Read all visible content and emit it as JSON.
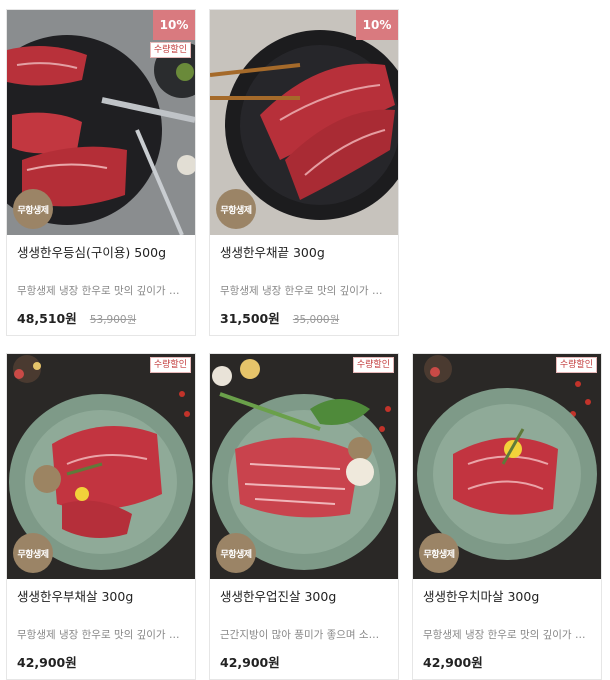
{
  "products": [
    {
      "name": "생생한우등심(구이용) 500g",
      "desc": "무항생제 냉장 한우로 맛의 깊이가 다르다",
      "price": "48,510원",
      "original_price": "53,900원",
      "discount": "10%",
      "tag": "수량할인",
      "badge": "무항생제"
    },
    {
      "name": "생생한우채끝 300g",
      "desc": "무항생제 냉장 한우로 맛의 깊이가 다르다",
      "price": "31,500원",
      "original_price": "35,000원",
      "discount": "10%",
      "tag": "",
      "badge": "무항생제"
    },
    {
      "name": "생생한우부채살 300g",
      "desc": "무항생제 냉장 한우로 맛의 깊이가 다르다",
      "price": "42,900원",
      "original_price": "",
      "discount": "",
      "tag": "수량할인",
      "badge": "무항생제"
    },
    {
      "name": "생생한우업진살 300g",
      "desc": "근간지방이 많아 풍미가 좋으며 소고기 본연의 맛",
      "price": "42,900원",
      "original_price": "",
      "discount": "",
      "tag": "수량할인",
      "badge": "무항생제"
    },
    {
      "name": "생생한우치마살 300g",
      "desc": "무항생제 냉장 한우로 맛의 깊이가 다르다",
      "price": "42,900원",
      "original_price": "",
      "discount": "",
      "tag": "수량할인",
      "badge": "무항생제"
    }
  ],
  "colors": {
    "discount_badge": "#d97a7f",
    "tag_text": "#c33d3d",
    "round_badge": "#9b8466"
  }
}
